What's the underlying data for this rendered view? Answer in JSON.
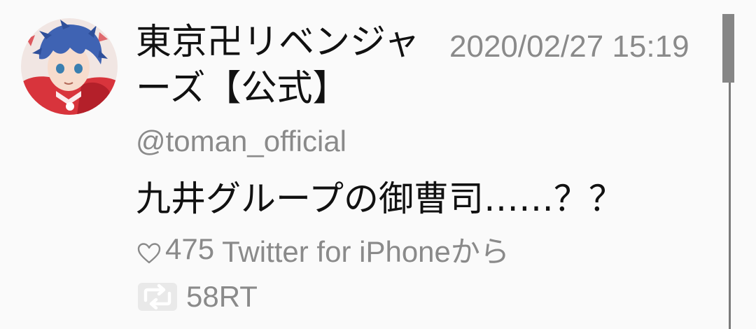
{
  "tweet": {
    "display_name": "東京卍リベンジャーズ【公式】",
    "timestamp": "2020/02/27 15:19",
    "handle": "@toman_official",
    "text": "九井グループの御曹司……？？",
    "likes": "475",
    "source": "Twitter for iPhoneから",
    "retweets": "58RT",
    "avatar_icon": "manga-character-avatar",
    "like_icon": "heart-outline-icon",
    "retweet_icon": "retweet-icon"
  },
  "colors": {
    "background": "#fafafa",
    "primary_text": "#111111",
    "secondary_text": "#8a8a8a",
    "scrollbar": "#868686"
  }
}
